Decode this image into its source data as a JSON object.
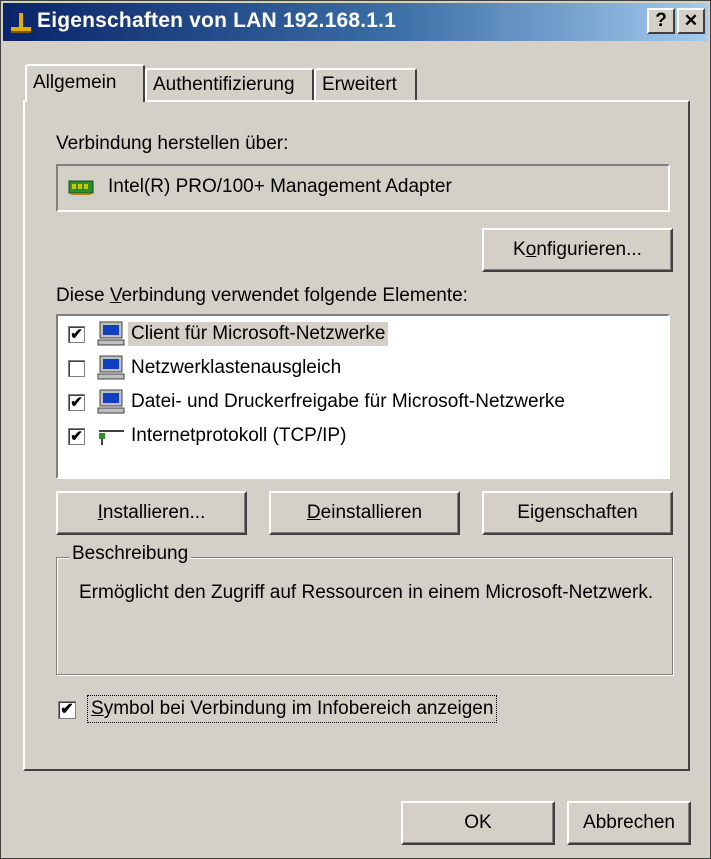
{
  "window": {
    "title": "Eigenschaften von LAN 192.168.1.1",
    "help_button": "?",
    "close_button": "✕"
  },
  "tabs": [
    {
      "label": "Allgemein",
      "active": true
    },
    {
      "label": "Authentifizierung",
      "active": false
    },
    {
      "label": "Erweitert",
      "active": false
    }
  ],
  "connection": {
    "label": "Verbindung herstellen über:",
    "adapter_name": "Intel(R) PRO/100+ Management Adapter",
    "adapter_icon": "network-card-icon",
    "configure_button": "Konfigurieren...",
    "configure_accel": "o"
  },
  "components": {
    "label_pre": "Diese ",
    "label_accel": "V",
    "label_post": "erbindung verwendet folgende Elemente:",
    "items": [
      {
        "label": "Client für Microsoft-Netzwerke",
        "checked": true,
        "selected": true,
        "icon": "computer-icon"
      },
      {
        "label": "Netzwerklastenausgleich",
        "checked": false,
        "selected": false,
        "icon": "computer-icon"
      },
      {
        "label": "Datei- und Druckerfreigabe für Microsoft-Netzwerke",
        "checked": true,
        "selected": false,
        "icon": "computer-icon"
      },
      {
        "label": "Internetprotokoll (TCP/IP)",
        "checked": true,
        "selected": false,
        "icon": "network-protocol-icon"
      }
    ]
  },
  "buttons": {
    "install_accel": "I",
    "install_rest": "nstallieren...",
    "uninstall_accel": "D",
    "uninstall_rest": "einstallieren",
    "properties_pre": "Ei",
    "properties_accel": "g",
    "properties_post": "enschaften",
    "ok": "OK",
    "cancel": "Abbrechen"
  },
  "description": {
    "title": "Beschreibung",
    "text": "Ermöglicht den Zugriff auf Ressourcen in einem Microsoft-Netzwerk."
  },
  "tray_option": {
    "accel": "S",
    "rest": "ymbol bei Verbindung im Infobereich anzeigen",
    "checked": true
  },
  "colors": {
    "title_gradient_start": "#0a246a",
    "title_gradient_end": "#a6caf0",
    "face": "#d4d0c8"
  }
}
